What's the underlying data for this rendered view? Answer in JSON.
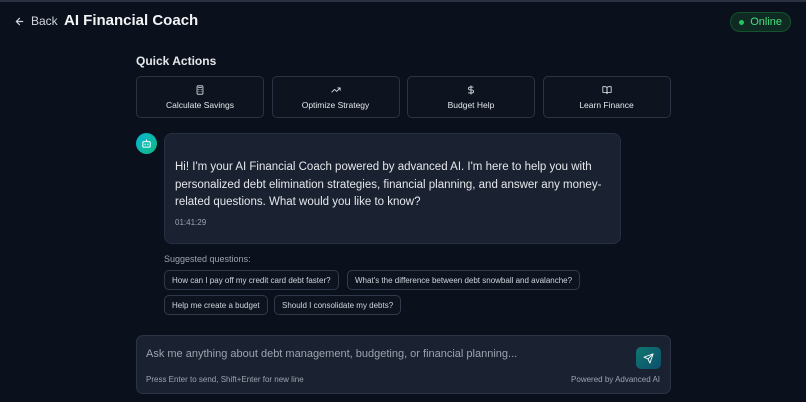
{
  "header": {
    "back_label": "Back",
    "title": "AI Financial Coach",
    "status": "Online"
  },
  "quick_actions": {
    "heading": "Quick Actions",
    "items": [
      {
        "label": "Calculate Savings",
        "icon": "calculator-icon"
      },
      {
        "label": "Optimize Strategy",
        "icon": "trending-up-icon"
      },
      {
        "label": "Budget Help",
        "icon": "dollar-sign-icon"
      },
      {
        "label": "Learn Finance",
        "icon": "book-open-icon"
      }
    ]
  },
  "message": {
    "avatar_icon": "bot-icon",
    "text": "Hi! I'm your AI Financial Coach powered by advanced AI. I'm here to help you with personalized debt elimination strategies, financial planning, and answer any money-related questions. What would you like to know?",
    "time": "01:41:29"
  },
  "suggestions": {
    "label": "Suggested questions:",
    "items": [
      "How can I pay off my credit card debt faster?",
      "What's the difference between debt snowball and avalanche?",
      "Help me create a budget",
      "Should I consolidate my debts?"
    ]
  },
  "composer": {
    "placeholder": "Ask me anything about debt management, budgeting, or financial planning...",
    "value": "",
    "hint": "Press Enter to send, Shift+Enter for new line",
    "powered_by": "Powered by Advanced AI",
    "send_icon": "send-icon"
  },
  "colors": {
    "background": "#0b111c",
    "card": "#1a2231",
    "online_green": "#22c55e",
    "accent_teal": "#0f766e"
  }
}
